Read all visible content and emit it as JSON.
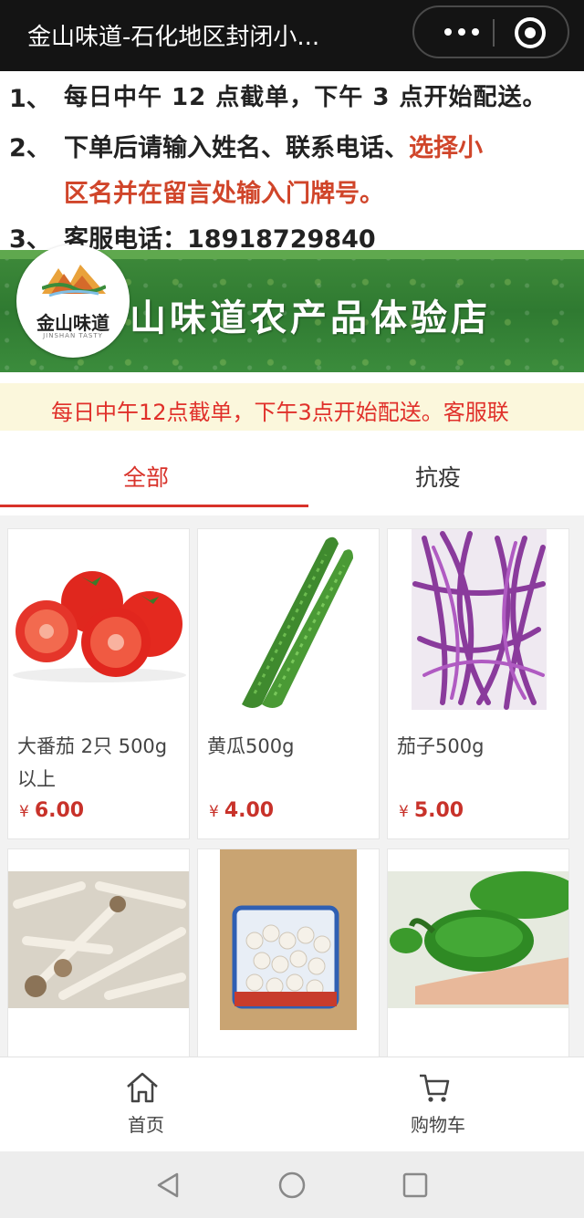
{
  "titlebar": {
    "title": "金山味道-石化地区封闭小..."
  },
  "notice": {
    "n1": "1、",
    "line1": "每日中午 12 点截单，下午 3 点开始配送。",
    "n2": "2、",
    "line2a_black": "下单后请输入姓名、联系电话、",
    "line2a_red": "选择小",
    "line2b": "区名并在留言处输入门牌号。",
    "n3": "3、",
    "line3": "客服电话：18918729840"
  },
  "banner": {
    "text": "山味道农产品体验店",
    "logo_text": "金山味道",
    "logo_sub": "JINSHAN TASTY"
  },
  "marquee": {
    "text": "每日中午12点截单，下午3点开始配送。客服联"
  },
  "tabs": [
    {
      "label": "全部",
      "active": true
    },
    {
      "label": "抗疫",
      "active": false
    }
  ],
  "products": [
    {
      "name": "大番茄 2只 500g以上",
      "currency": "¥",
      "price": "6.00",
      "image": "tomato"
    },
    {
      "name": "黄瓜500g",
      "currency": "¥",
      "price": "4.00",
      "image": "cucumber"
    },
    {
      "name": "茄子500g",
      "currency": "¥",
      "price": "5.00",
      "image": "eggplant"
    },
    {
      "name": "",
      "currency": "",
      "price": "",
      "image": "mushroom-seafood"
    },
    {
      "name": "",
      "currency": "",
      "price": "",
      "image": "mushroom-white-pack"
    },
    {
      "name": "",
      "currency": "",
      "price": "",
      "image": "green-pepper"
    }
  ],
  "tabbar": [
    {
      "label": "首页",
      "icon": "home-icon"
    },
    {
      "label": "购物车",
      "icon": "cart-icon"
    }
  ],
  "colors": {
    "accent": "#d8322a",
    "titlebar": "#141414",
    "marquee_bg": "#fbf7dc"
  }
}
